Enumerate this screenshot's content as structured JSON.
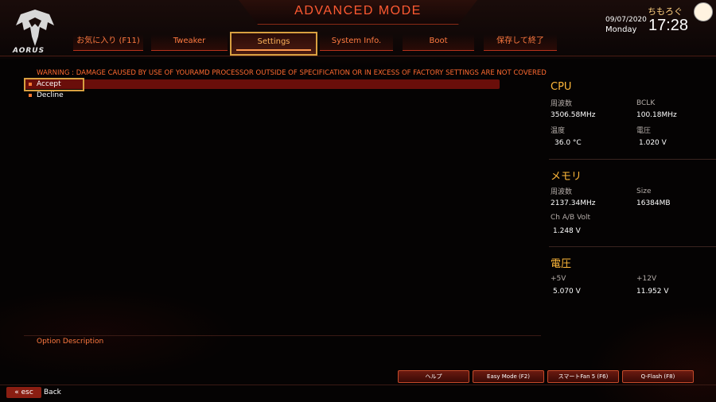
{
  "header": {
    "title": "ADVANCED MODE",
    "logo_text": "AORUS",
    "date": "09/07/2020",
    "day": "Monday",
    "time": "17:28",
    "watermark": "ちもろぐ",
    "tabs": [
      {
        "label": "お気に入り (F11)",
        "active": false
      },
      {
        "label": "Tweaker",
        "active": false
      },
      {
        "label": "Settings",
        "active": true
      },
      {
        "label": "System Info.",
        "active": false
      },
      {
        "label": "Boot",
        "active": false
      },
      {
        "label": "保存して終了",
        "active": false
      }
    ]
  },
  "main": {
    "warning": "WARNING : DAMAGE CAUSED BY USE OF YOURAMD PROCESSOR OUTSIDE OF SPECIFICATION OR IN EXCESS OF FACTORY SETTINGS ARE NOT COVERED",
    "options": [
      {
        "label": "Accept",
        "selected": true
      },
      {
        "label": "Decline",
        "selected": false
      }
    ],
    "option_description_label": "Option Description"
  },
  "system": {
    "cpu": {
      "heading": "CPU",
      "freq_label": "周波数",
      "freq_value": "3506.58MHz",
      "bclk_label": "BCLK",
      "bclk_value": "100.18MHz",
      "temp_label": "温度",
      "temp_value": "36.0 °C",
      "volt_label": "電圧",
      "volt_value": "1.020 V"
    },
    "memory": {
      "heading": "メモリ",
      "freq_label": "周波数",
      "freq_value": "2137.34MHz",
      "size_label": "Size",
      "size_value": "16384MB",
      "volt_label": "Ch A/B Volt",
      "volt_value": "1.248 V"
    },
    "voltage": {
      "heading": "電圧",
      "v5_label": "+5V",
      "v5_value": "5.070 V",
      "v12_label": "+12V",
      "v12_value": "11.952 V"
    }
  },
  "footer": {
    "buttons": [
      "ヘルプ",
      "Easy Mode (F2)",
      "スマートFan 5 (F6)",
      "Q-Flash (F8)"
    ],
    "esc_label": "esc",
    "back_label": "Back"
  },
  "colors": {
    "accent": "#ff6a30",
    "highlight": "#d8a040",
    "selection": "#6a0e0a",
    "heading": "#ffb83a"
  }
}
